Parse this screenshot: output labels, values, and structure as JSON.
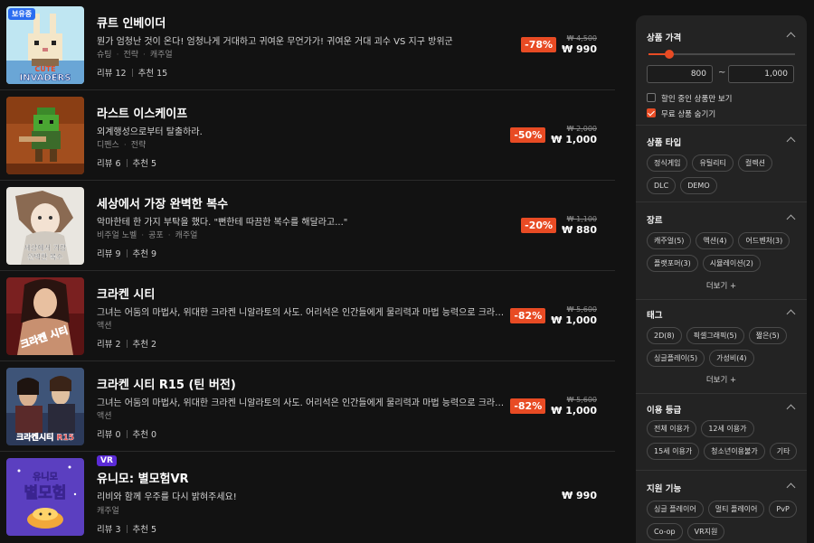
{
  "games": [
    {
      "badge": "보유중",
      "title": "큐트 인베이더",
      "desc": "뭔가 엄청난 것이 온다! 엄청나게 거대하고 귀여운 무언가가! 귀여운 거대 괴수 VS 지구 방위군",
      "cats": [
        "슈팅",
        "전략",
        "캐주얼"
      ],
      "reviews": "리뷰 12",
      "recs": "추천 15",
      "discount": "-78%",
      "original": "₩ 4,500",
      "price": "₩ 990",
      "thumb_text": "CUTE INVADERS"
    },
    {
      "title": "라스트 이스케이프",
      "desc": "외계행성으로부터 탈출하라.",
      "cats": [
        "디펜스",
        "전략"
      ],
      "reviews": "리뷰 6",
      "recs": "추천 5",
      "discount": "-50%",
      "original": "₩ 2,000",
      "price": "₩ 1,000"
    },
    {
      "title": "세상에서 가장 완벽한 복수",
      "desc": "악마한테 한 가지 부탁을 했다. \"뻔한테 따끔한 복수를 해달라고...\"",
      "cats": [
        "비주얼 노벨",
        "공포",
        "캐주얼"
      ],
      "reviews": "리뷰 9",
      "recs": "추천 9",
      "discount": "-20%",
      "original": "₩ 1,100",
      "price": "₩ 880",
      "thumb_text": [
        "세상에서 가장",
        "완벽한 복수"
      ]
    },
    {
      "title": "크라켄 시티",
      "desc": "그녀는 어둠의 마법사, 위대한 크라켄 니알라토의 사도. 어리석은 인간들에게 물리력과 마법 능력으로 크라켄의 무서움을 알려주세요.",
      "cats": [
        "액션"
      ],
      "reviews": "리뷰 2",
      "recs": "추천 2",
      "discount": "-82%",
      "original": "₩ 5,600",
      "price": "₩ 1,000",
      "thumb_text": "크라켄 시티"
    },
    {
      "title": "크라켄 시티 R15 (틴 버전)",
      "desc": "그녀는 어둠의 마법사, 위대한 크라켄 니알라토의 사도. 어리석은 인간들에게 물리력과 마법 능력으로 크라켄의 무서움을 알려주세요.",
      "cats": [
        "액션"
      ],
      "reviews": "리뷰 0",
      "recs": "추천 0",
      "discount": "-82%",
      "original": "₩ 5,600",
      "price": "₩ 1,000",
      "thumb_text": "크라켄시티 R15"
    },
    {
      "badge": "VR",
      "title": "유니모: 별모험VR",
      "desc": "리비와 함께 우주를 다시 밝혀주세요!",
      "cats": [
        "캐주얼"
      ],
      "reviews": "리뷰 3",
      "recs": "추천 5",
      "price": "₩ 990",
      "thumb_text": [
        "유니모",
        "별모험"
      ]
    }
  ],
  "filters": {
    "price": {
      "heading": "상품 가격",
      "min": "800",
      "max": "1,000",
      "tilde": "~",
      "slider_min_fraction": 0.14,
      "slider_max_fraction": 1.0,
      "discount_only": "할인 중인 상품만 보기",
      "discount_only_checked": false,
      "hide_free": "무료 상품 숨기기",
      "hide_free_checked": true
    },
    "type": {
      "heading": "상품 타입",
      "chips": [
        "정식게임",
        "유틸리티",
        "컬렉션",
        "DLC",
        "DEMO"
      ]
    },
    "genre": {
      "heading": "장르",
      "chips": [
        "캐주얼(5)",
        "액션(4)",
        "어드벤처(3)",
        "플랫포머(3)",
        "시뮬레이션(2)"
      ],
      "more": "더보기 +"
    },
    "tags": {
      "heading": "태그",
      "chips": [
        "2D(8)",
        "픽셀그래픽(5)",
        "짧은(5)",
        "싱글플레이(5)",
        "가성비(4)"
      ],
      "more": "더보기 +"
    },
    "rating": {
      "heading": "이용 등급",
      "chips": [
        "전체 이용가",
        "12세 이용가",
        "15세 이용가",
        "청소년이용불가",
        "기타"
      ]
    },
    "features": {
      "heading": "지원 기능",
      "chips": [
        "싱글 플레이어",
        "멀티 플레이어",
        "PvP",
        "Co-op",
        "VR지원"
      ]
    }
  },
  "colors": {
    "accent": "#e84b24",
    "vr_badge": "#5b2bd6",
    "owned_badge": "#2b6cf0",
    "panel": "#232323",
    "background": "#121212"
  }
}
